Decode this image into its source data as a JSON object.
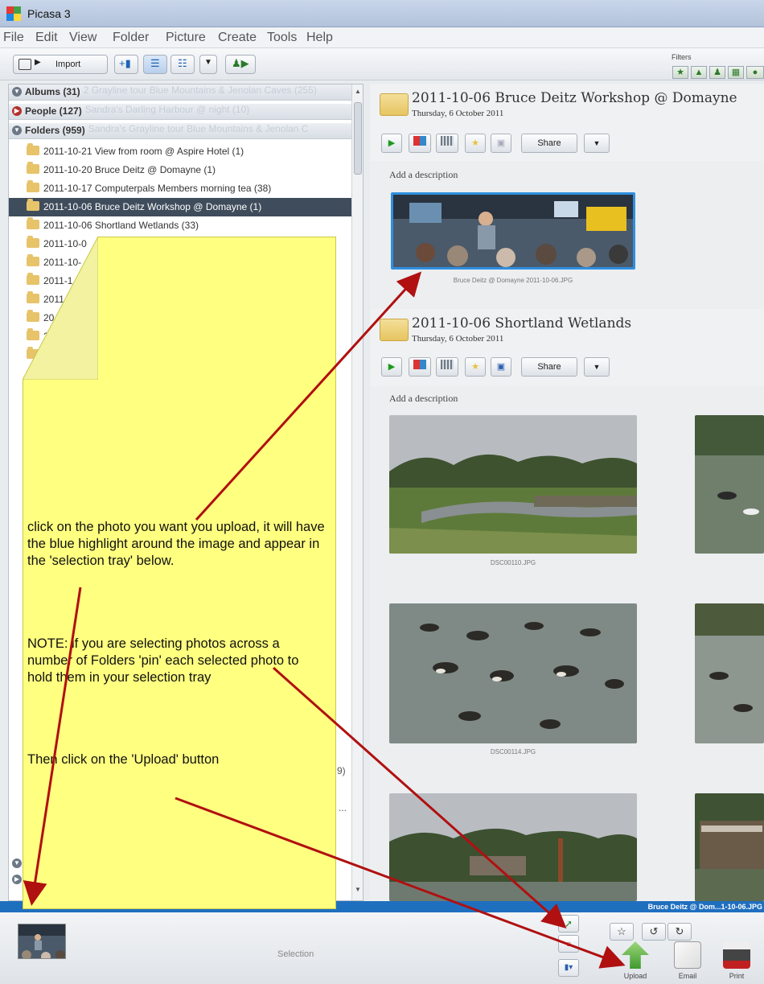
{
  "window": {
    "title": "Picasa 3"
  },
  "menu": [
    "File",
    "Edit",
    "View",
    "Folder",
    "Picture",
    "Create",
    "Tools",
    "Help"
  ],
  "toolbar": {
    "import_label": "Import",
    "filters_label": "Filters"
  },
  "library": {
    "groups": [
      {
        "label": "Albums (31)",
        "ghost": "2 Grayline tour Blue Mountains & Jenolan Caves (255)"
      },
      {
        "label": "People (127)",
        "ghost": "Sandra's Darling Harbour @ night (10)"
      },
      {
        "label": "Folders (959)",
        "ghost": "Sandra's Grayline tour Blue Mountains & Jenolan C"
      }
    ],
    "folders": [
      "2011-10-21 View from room @ Aspire Hotel (1)",
      "2011-10-20 Bruce Deitz @ Domayne (1)",
      "2011-10-17 Computerpals Members morning tea (38)",
      "2011-10-06 Bruce Deitz Workshop @ Domayne (1)",
      "2011-10-06 Shortland Wetlands (33)",
      "2011-10-0",
      "2011-10-",
      "2011-1",
      "2011",
      "20",
      "2",
      ""
    ],
    "hidden_fragments": [
      "9)",
      "..."
    ]
  },
  "albums": [
    {
      "title": "2011-10-06 Bruce Deitz Workshop @ Domayne",
      "date": "Thursday, 6 October 2011",
      "share_label": "Share",
      "description_placeholder": "Add a description",
      "photos": [
        {
          "caption": "Bruce Deitz @ Domayne 2011-10-06.JPG",
          "selected": true
        }
      ]
    },
    {
      "title": "2011-10-06 Shortland Wetlands",
      "date": "Thursday, 6 October 2011",
      "share_label": "Share",
      "description_placeholder": "Add a description",
      "photos": [
        {
          "caption": "DSC00110.JPG"
        },
        {
          "caption": ""
        },
        {
          "caption": "DSC00114.JPG"
        },
        {
          "caption": ""
        },
        {
          "caption": ""
        },
        {
          "caption": ""
        }
      ]
    }
  ],
  "status": {
    "filename": "Bruce Deitz @ Dom...1-10-06.JPG"
  },
  "tray": {
    "label": "Selection",
    "actions": [
      {
        "label": "Upload"
      },
      {
        "label": "Email"
      },
      {
        "label": "Print"
      }
    ]
  },
  "note": {
    "para1": "click on the photo you want you upload, it will have the blue highlight around the image and appear in the 'selection tray' below.",
    "para2": "NOTE: if you are selecting photos across a number of Folders 'pin' each selected photo to hold them in your selection tray",
    "para3": "Then click on the 'Upload' button"
  },
  "colors": {
    "highlight": "#3f4c5c",
    "selection_border": "#2f8fe0",
    "status_bar": "#1f6fbf",
    "note_bg": "#ffff80",
    "arrow": "#b01010"
  }
}
